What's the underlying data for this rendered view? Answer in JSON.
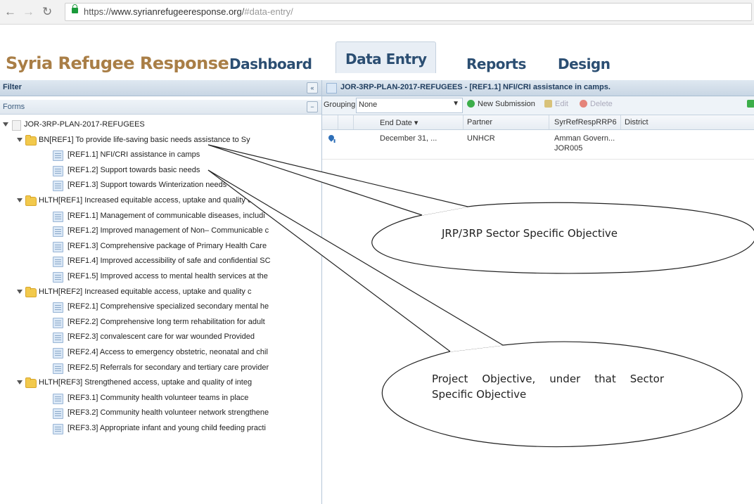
{
  "browser": {
    "url_scheme": "https://",
    "url_host": "www.syrianrefugeeresponse.org",
    "url_path": "/",
    "url_fragment": "#data-entry/"
  },
  "header": {
    "title": "Syria Refugee Response",
    "nav": [
      "Dashboard",
      "Data Entry",
      "Reports",
      "Design"
    ],
    "active_nav": "Data Entry",
    "title_color": "#a97e46",
    "nav_color": "#2b4e72"
  },
  "left_panel": {
    "filter_label": "Filter",
    "forms_label": "Forms",
    "tree": [
      {
        "type": "root",
        "label": "JOR-3RP-PLAN-2017-REFUGEES"
      },
      {
        "type": "folder",
        "label": "BN[REF1] To provide life-saving basic needs assistance to Sy"
      },
      {
        "type": "leaf",
        "label": "[REF1.1] NFI/CRI assistance in camps"
      },
      {
        "type": "leaf",
        "label": "[REF1.2] Support towards basic needs"
      },
      {
        "type": "leaf",
        "label": "[REF1.3] Support towards Winterization needs"
      },
      {
        "type": "folder",
        "label": "HLTH[REF1] Increased equitable access, uptake and quality c"
      },
      {
        "type": "leaf",
        "label": "[REF1.1] Management of communicable diseases, includi"
      },
      {
        "type": "leaf",
        "label": "[REF1.2] Improved management of Non– Communicable c"
      },
      {
        "type": "leaf",
        "label": "[REF1.3] Comprehensive package of Primary Health Care"
      },
      {
        "type": "leaf",
        "label": "[REF1.4] Improved accessibility of safe and confidential SC"
      },
      {
        "type": "leaf",
        "label": "[REF1.5] Improved access to mental health services at the"
      },
      {
        "type": "folder",
        "label": "HLTH[REF2] Increased equitable access, uptake and quality c"
      },
      {
        "type": "leaf",
        "label": "[REF2.1] Comprehensive specialized secondary mental he"
      },
      {
        "type": "leaf",
        "label": "[REF2.2] Comprehensive long term rehabilitation for adult"
      },
      {
        "type": "leaf",
        "label": "[REF2.3] convalescent care for war wounded Provided"
      },
      {
        "type": "leaf",
        "label": "[REF2.4] Access to emergency obstetric, neonatal and chil"
      },
      {
        "type": "leaf",
        "label": "[REF2.5] Referrals for secondary and tertiary care provider"
      },
      {
        "type": "folder",
        "label": "HLTH[REF3] Strengthened access, uptake and quality of integ"
      },
      {
        "type": "leaf",
        "label": "[REF3.1] Community health volunteer teams in place"
      },
      {
        "type": "leaf",
        "label": "[REF3.2] Community health volunteer network strengthene"
      },
      {
        "type": "leaf",
        "label": "[REF3.3] Appropriate infant and young child feeding practi"
      }
    ]
  },
  "right_panel": {
    "title": "JOR-3RP-PLAN-2017-REFUGEES - [REF1.1] NFI/CRI assistance in camps.",
    "grouping_label": "Grouping",
    "grouping_value": "None",
    "buttons": {
      "new_submission": "New Submission",
      "edit": "Edit",
      "delete": "Delete"
    },
    "columns": [
      "End Date ▾",
      "Partner",
      "SyrRefRespRRP6",
      "District"
    ],
    "rows": [
      {
        "end_date": "December 31, ...",
        "partner": "UNHCR",
        "location_line1": "Amman Govern...",
        "location_line2": "JOR005",
        "district": ""
      }
    ]
  },
  "annotations": {
    "callout1": "JRP/3RP Sector Specific Objective",
    "callout2": "Project Objective, under that Sector Specific Objective"
  }
}
